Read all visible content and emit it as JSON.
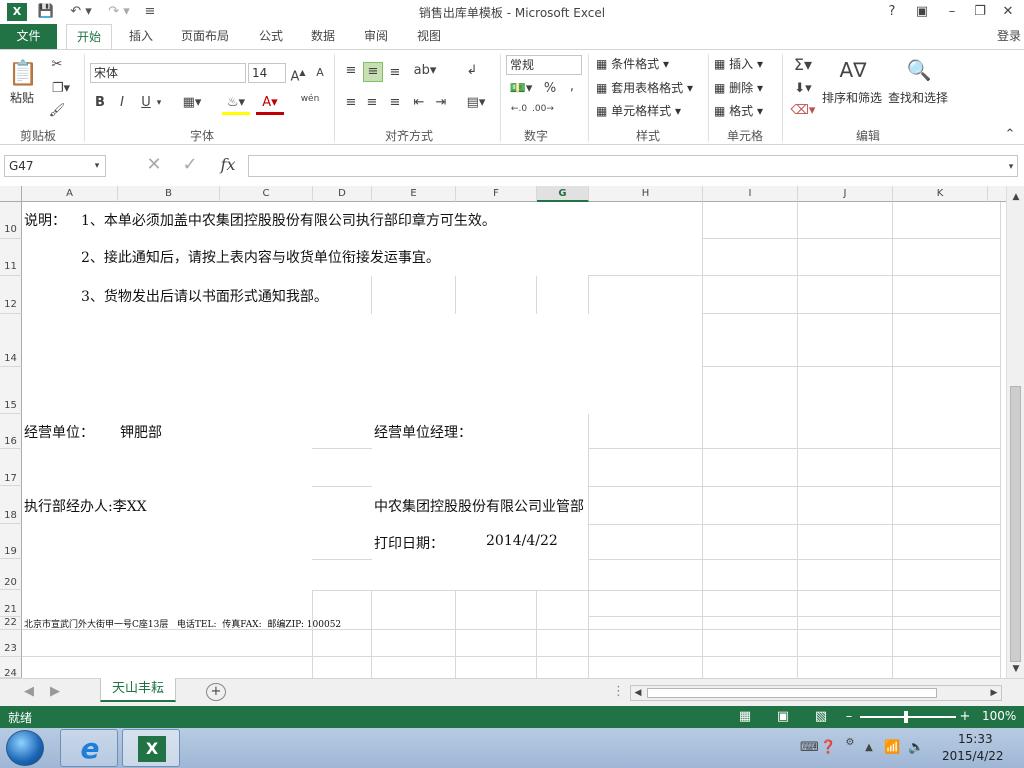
{
  "app": {
    "title": "销售出库单模板 - Microsoft Excel",
    "help_label": "?",
    "login_label": "登录"
  },
  "tabs": [
    "文件",
    "开始",
    "插入",
    "页面布局",
    "公式",
    "数据",
    "审阅",
    "视图"
  ],
  "ribbon": {
    "clipboard": {
      "paste_label": "粘贴",
      "group_label": "剪贴板"
    },
    "font": {
      "name": "宋体",
      "size": "14",
      "group_label": "字体",
      "bold": "B",
      "italic": "I",
      "underline": "U",
      "phonetic": "wén"
    },
    "alignment": {
      "group_label": "对齐方式"
    },
    "number": {
      "format": "常规",
      "group_label": "数字",
      "percent": "%",
      "comma": ","
    },
    "styles": {
      "conditional": "条件格式",
      "table": "套用表格格式",
      "cell_styles": "单元格样式",
      "group_label": "样式"
    },
    "cells": {
      "insert": "插入",
      "delete": "删除",
      "format": "格式",
      "group_label": "单元格"
    },
    "editing": {
      "sort_filter": "排序和筛选",
      "find_select": "查找和选择",
      "group_label": "编辑"
    }
  },
  "formula_bar": {
    "name_box": "G47",
    "fx": "fx",
    "value": ""
  },
  "columns": [
    "A",
    "B",
    "C",
    "D",
    "E",
    "F",
    "G",
    "H",
    "I",
    "J",
    "K"
  ],
  "rows": [
    "10",
    "11",
    "12",
    "14",
    "15",
    "16",
    "17",
    "18",
    "19",
    "20",
    "21",
    "22",
    "23",
    "24"
  ],
  "sheet": {
    "note_label": "说明：",
    "note1": "1、本单必须加盖中农集团控股股份有限公司执行部印章方可生效。",
    "note2": "2、接此通知后，请按上表内容与收货单位衔接发运事宜。",
    "note3": "3、货物发出后请以书面形式通知我部。",
    "unit_label": "经营单位：",
    "unit_value": "钾肥部",
    "manager_label": "经营单位经理：",
    "handler": "执行部经办人:李XX",
    "company": "中农集团控股股份有限公司业管部",
    "print_date_label": "打印日期：",
    "print_date_value": "2014/4/22",
    "address": "北京市宣武门外大街甲一号C座13层   电话TEL:  传真FAX:  邮编ZIP: 100052"
  },
  "sheet_tabs": [
    "天山丰耘"
  ],
  "status": {
    "ready": "就绪",
    "zoom": "100%"
  },
  "taskbar": {
    "time": "15:33",
    "date": "2015/4/22"
  },
  "colors": {
    "excel_green": "#217346",
    "taskbar": "#a9bfdc"
  }
}
